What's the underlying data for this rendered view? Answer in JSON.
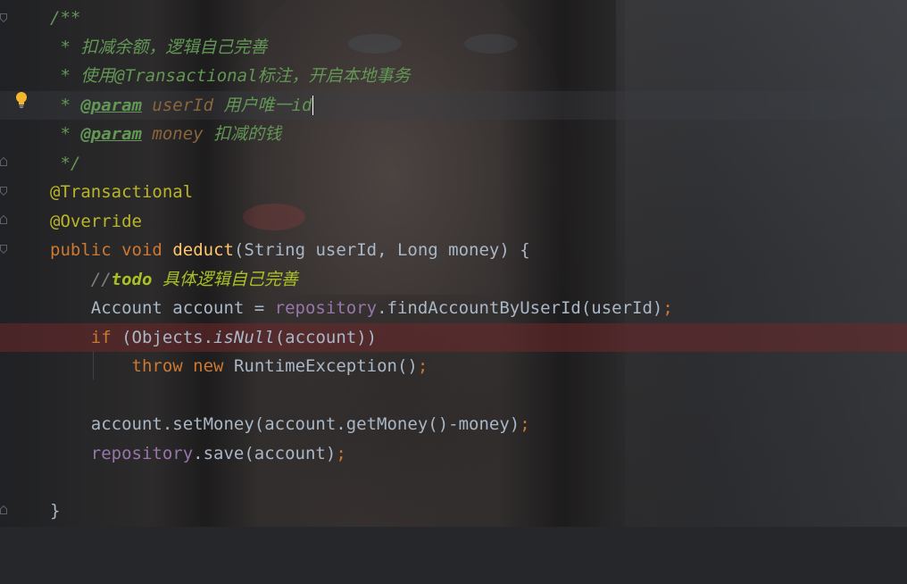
{
  "editor": {
    "lines": [
      {
        "doc_open": "/**"
      },
      {
        "doc_star": " * ",
        "doc_text": "扣减余额，逻辑自己完善"
      },
      {
        "doc_star": " * ",
        "doc_text": "使用@Transactional标注，开启本地事务"
      },
      {
        "doc_star": " * ",
        "tag": "@param",
        "param": "userId",
        "desc": "用户唯一id"
      },
      {
        "doc_star": " * ",
        "tag": "@param",
        "param": "money",
        "desc": "扣减的钱"
      },
      {
        "doc_close": " */"
      },
      {
        "annotation": "@Transactional"
      },
      {
        "annotation": "@Override"
      },
      {
        "kw1": "public",
        "kw2": "void",
        "name": "deduct",
        "params": "(String userId, Long money) {"
      },
      {
        "comment": "//",
        "todo": "todo",
        "todo_text": " 具体逻辑自己完善"
      },
      {
        "type": "Account account = ",
        "field": "repository",
        "call": ".findAccountByUserId(userId)",
        "semi": ";"
      },
      {
        "kw": "if",
        "pre": " (Objects.",
        "static_call": "isNull",
        "post": "(account))"
      },
      {
        "kw1": "throw",
        "kw2": "new",
        "rest": " RuntimeException()",
        "semi": ";"
      },
      {
        "stmt": "account.setMoney(account.getMoney()-money)",
        "semi": ";"
      },
      {
        "field": "repository",
        "call": ".save(account)",
        "semi": ";"
      },
      {
        "close": "}"
      }
    ]
  },
  "colors": {
    "doc_comment": "#629755",
    "keyword": "#cc7832",
    "annotation": "#bbb529",
    "method": "#ffc66d",
    "field": "#9876aa",
    "text": "#a9b7c6",
    "error_line": "#6e282a"
  },
  "gutter": {
    "intention_icon": "lightbulb-icon",
    "fold_icon": "fold-marker-icon"
  }
}
